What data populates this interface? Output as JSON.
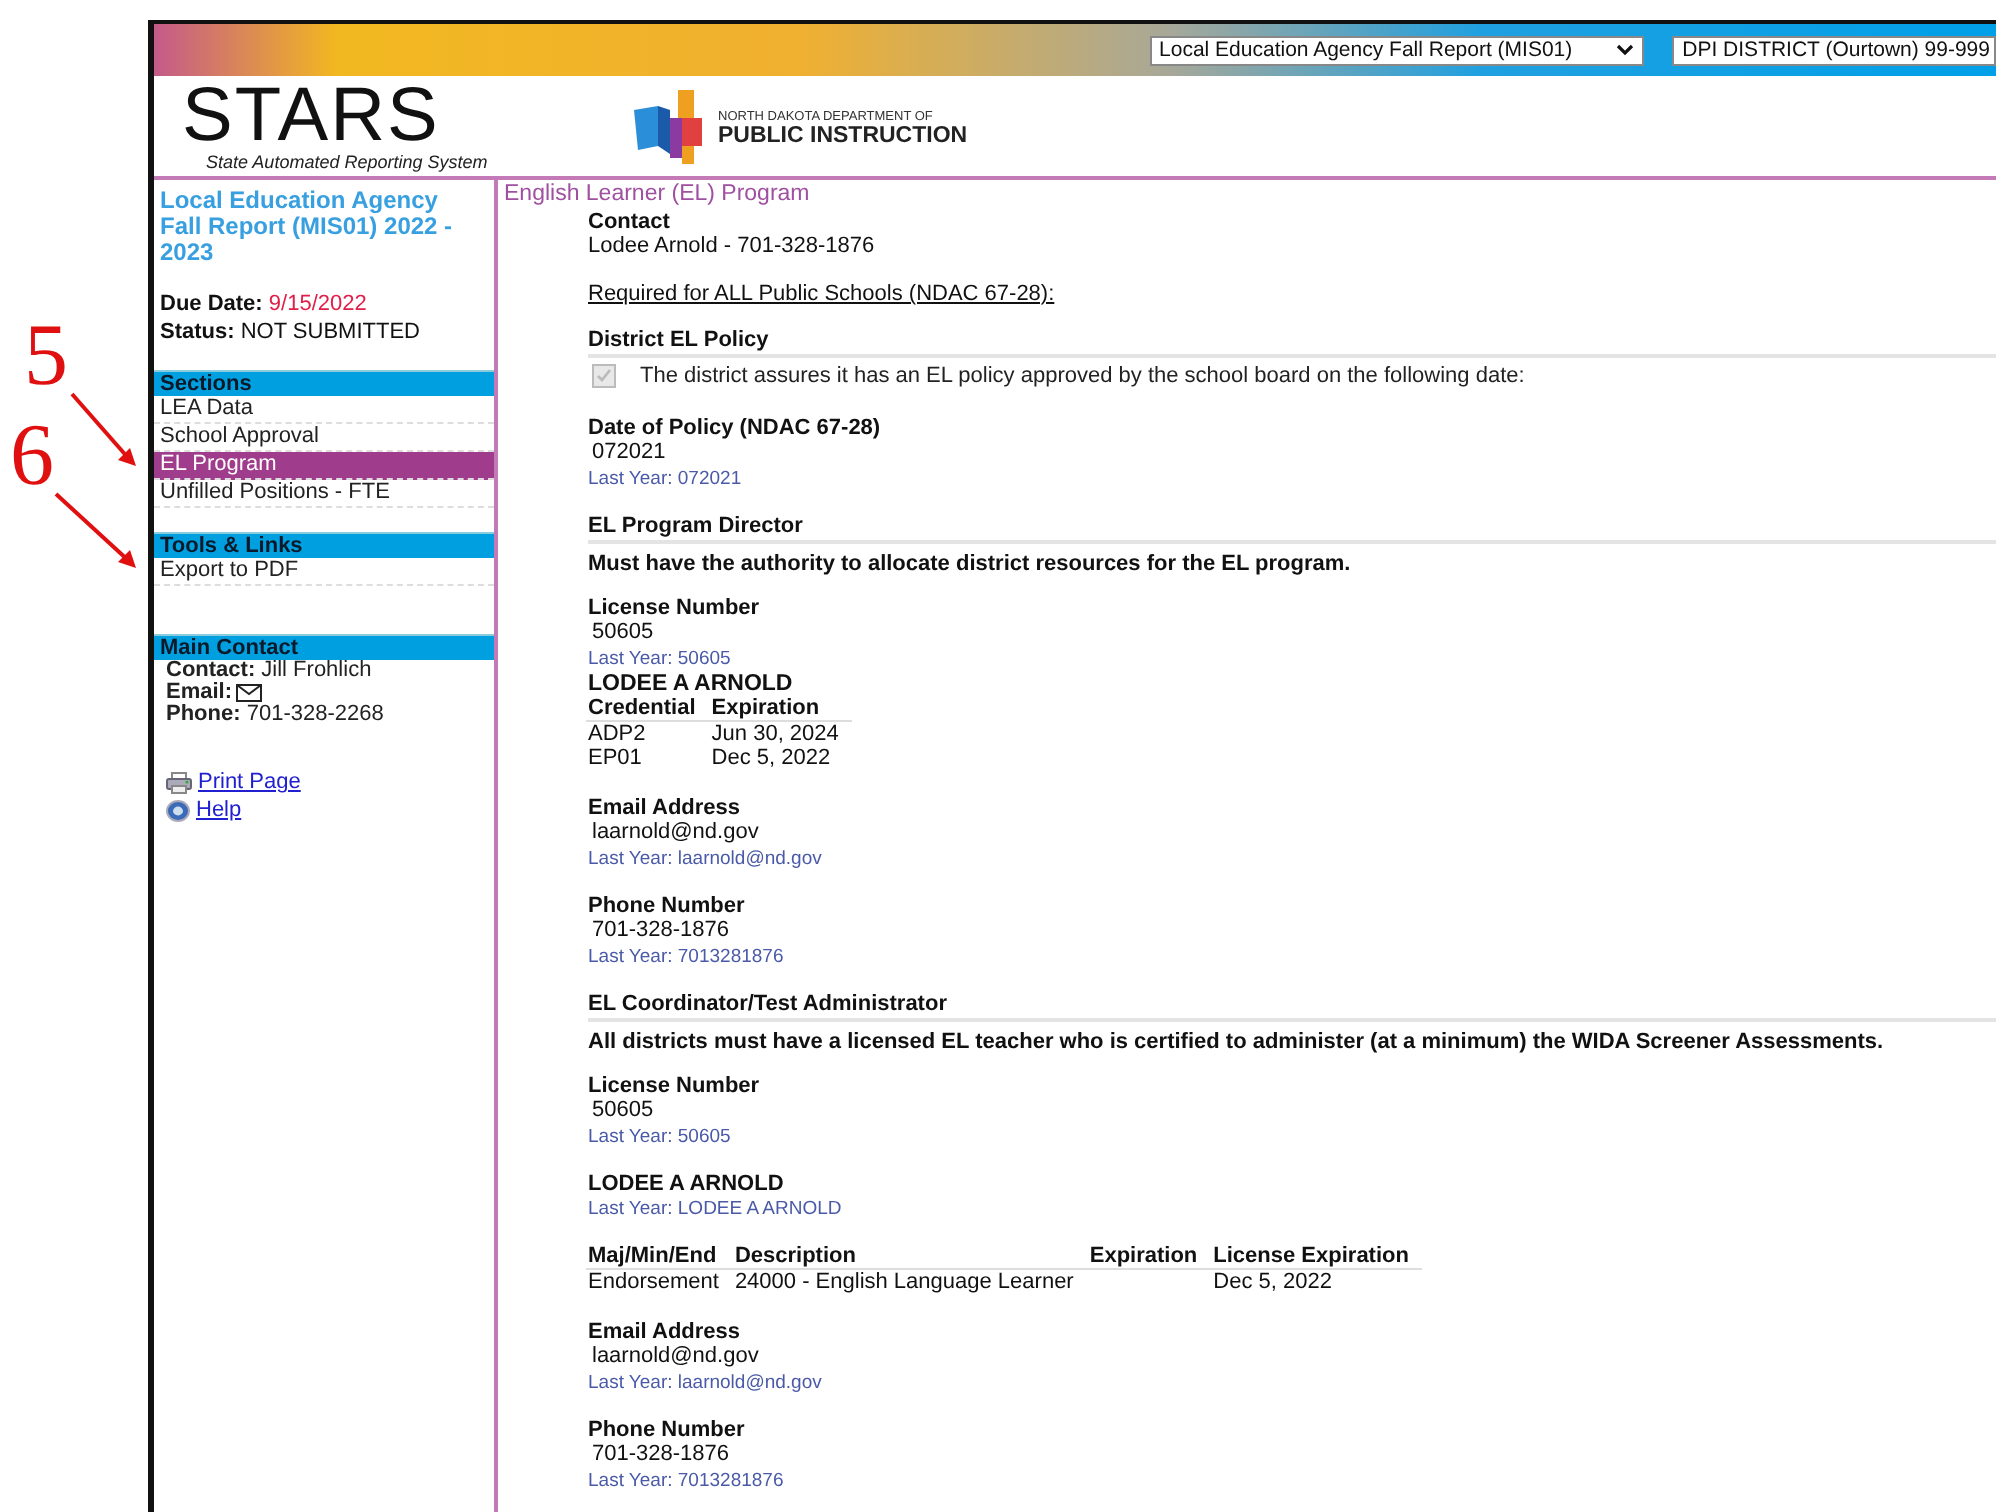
{
  "annotations": [
    {
      "label": "5"
    },
    {
      "label": "6"
    }
  ],
  "topbar": {
    "report_select": "Local Education Agency Fall Report (MIS01)",
    "district_select": "DPI DISTRICT (Ourtown) 99-999"
  },
  "logo": {
    "title": "STARS",
    "subtitle": "State Automated Reporting System"
  },
  "agency": {
    "line1": "NORTH DAKOTA DEPARTMENT OF",
    "line2": "PUBLIC INSTRUCTION"
  },
  "sidebar": {
    "report_title": "Local Education Agency Fall Report (MIS01) 2022 - 2023",
    "due_label": "Due Date:",
    "due_value": "9/15/2022",
    "status_label": "Status:",
    "status_value": "NOT SUBMITTED",
    "sections": {
      "title": "Sections",
      "items": [
        {
          "label": "LEA Data",
          "selected": false
        },
        {
          "label": "School Approval",
          "selected": false
        },
        {
          "label": "EL Program",
          "selected": true
        },
        {
          "label": "Unfilled Positions - FTE",
          "selected": false
        }
      ]
    },
    "tools": {
      "title": "Tools & Links",
      "items": [
        {
          "label": "Export to PDF",
          "selected": false
        }
      ]
    },
    "main_contact": {
      "title": "Main Contact",
      "contact_label": "Contact:",
      "contact_value": "Jill Frohlich",
      "email_label": "Email:",
      "phone_label": "Phone:",
      "phone_value": "701-328-2268"
    },
    "links": [
      {
        "label": "Print Page",
        "kind": "print"
      },
      {
        "label": "Help",
        "kind": "help"
      }
    ]
  },
  "content": {
    "title": "English Learner (EL) Program",
    "blocks": [
      {
        "kind": "field",
        "label": "Contact",
        "value": "Lodee Arnold - 701-328-1876"
      },
      {
        "kind": "underlined",
        "text": "Required for ALL Public Schools (NDAC 67-28):"
      },
      {
        "kind": "heading",
        "text": "District EL Policy"
      },
      {
        "kind": "checkbox",
        "text": "The district assures it has an EL policy approved by the school board on the following date:",
        "checked": true,
        "disabled": true
      },
      {
        "kind": "field",
        "label": "Date of Policy (NDAC 67-28)",
        "value": "072021",
        "last_year": "Last Year: 072021"
      },
      {
        "kind": "heading",
        "text": "EL Program Director"
      },
      {
        "kind": "note",
        "text": "Must have the authority to allocate district resources for the EL program."
      },
      {
        "kind": "field",
        "label": "License Number",
        "value": "50605",
        "last_year": "Last Year: 50605"
      },
      {
        "kind": "name",
        "text": "LODEE A ARNOLD"
      },
      {
        "kind": "table",
        "columns": [
          "Credential",
          "Expiration"
        ],
        "rows": [
          [
            "ADP2",
            "Jun 30, 2024"
          ],
          [
            "EP01",
            "Dec 5, 2022"
          ]
        ]
      },
      {
        "kind": "field",
        "label": "Email Address",
        "value": "laarnold@nd.gov",
        "last_year": "Last Year: laarnold@nd.gov"
      },
      {
        "kind": "field",
        "label": "Phone Number",
        "value": "701-328-1876",
        "last_year": "Last Year: 7013281876"
      },
      {
        "kind": "heading",
        "text": "EL Coordinator/Test Administrator"
      },
      {
        "kind": "note",
        "text": "All districts must have a licensed EL teacher who is certified to administer (at a minimum) the WIDA Screener Assessments."
      },
      {
        "kind": "field",
        "label": "License Number",
        "value": "50605",
        "last_year": "Last Year: 50605"
      },
      {
        "kind": "field",
        "label": "LODEE A ARNOLD",
        "last_year": "Last Year: LODEE A ARNOLD"
      },
      {
        "kind": "table",
        "columns": [
          "Maj/Min/End",
          "Description",
          "Expiration",
          "License Expiration"
        ],
        "rows": [
          [
            "Endorsement",
            "24000 - English Language Learner",
            null,
            "Dec 5, 2022"
          ]
        ]
      },
      {
        "kind": "field",
        "label": "Email Address",
        "value": "laarnold@nd.gov",
        "last_year": "Last Year: laarnold@nd.gov"
      },
      {
        "kind": "field",
        "label": "Phone Number",
        "value": "701-328-1876",
        "last_year": "Last Year: 7013281876"
      }
    ]
  }
}
